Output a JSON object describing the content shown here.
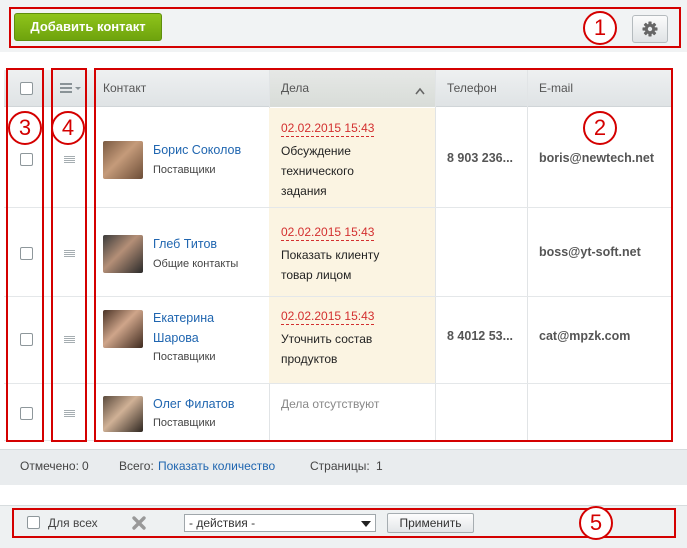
{
  "toolbar": {
    "add_contact_label": "Добавить контакт",
    "settings_icon": "gear-icon"
  },
  "grid": {
    "headers": {
      "contact": "Контакт",
      "deals": "Дела",
      "phone": "Телефон",
      "email": "E-mail"
    },
    "deals_sort": "ascending",
    "rows": [
      {
        "name": "Борис Соколов",
        "type": "Поставщики",
        "date": "02.02.2015 15:43",
        "deal_line1": "Обсуждение",
        "deal_line2": "технического",
        "deal_line3": "задания",
        "phone": "8 903 236...",
        "email": "boris@newtech.net"
      },
      {
        "name": "Глеб Титов",
        "type": "Общие контакты",
        "date": "02.02.2015 15:43",
        "deal_line1": "Показать клиенту",
        "deal_line2": "товар лицом",
        "phone": "",
        "email": "boss@yt-soft.net"
      },
      {
        "name_line1": "Екатерина",
        "name_line2": "Шарова",
        "type": "Поставщики",
        "date": "02.02.2015 15:43",
        "deal_line1": "Уточнить состав",
        "deal_line2": "продуктов",
        "phone": "8 4012 53...",
        "email": "cat@mpzk.com"
      },
      {
        "name": "Олег Филатов",
        "type": "Поставщики",
        "deals_empty": "Дела отсутствуют",
        "phone": "",
        "email": ""
      }
    ]
  },
  "footer": {
    "checked_label": "Отмечено:",
    "checked_value": "0",
    "total_label": "Всего:",
    "total_link": "Показать количество",
    "pages_label": "Страницы:",
    "pages_value": "1"
  },
  "actions": {
    "for_all_label": "Для всех",
    "delete_icon": "close-x-icon",
    "select_value": "- действия -",
    "apply_label": "Применить"
  },
  "callouts": [
    "1",
    "2",
    "3",
    "4",
    "5"
  ],
  "colors": {
    "accent_red": "#d40000",
    "link": "#2066b0",
    "date": "#d32f2f",
    "add_button": "#7cb515"
  }
}
